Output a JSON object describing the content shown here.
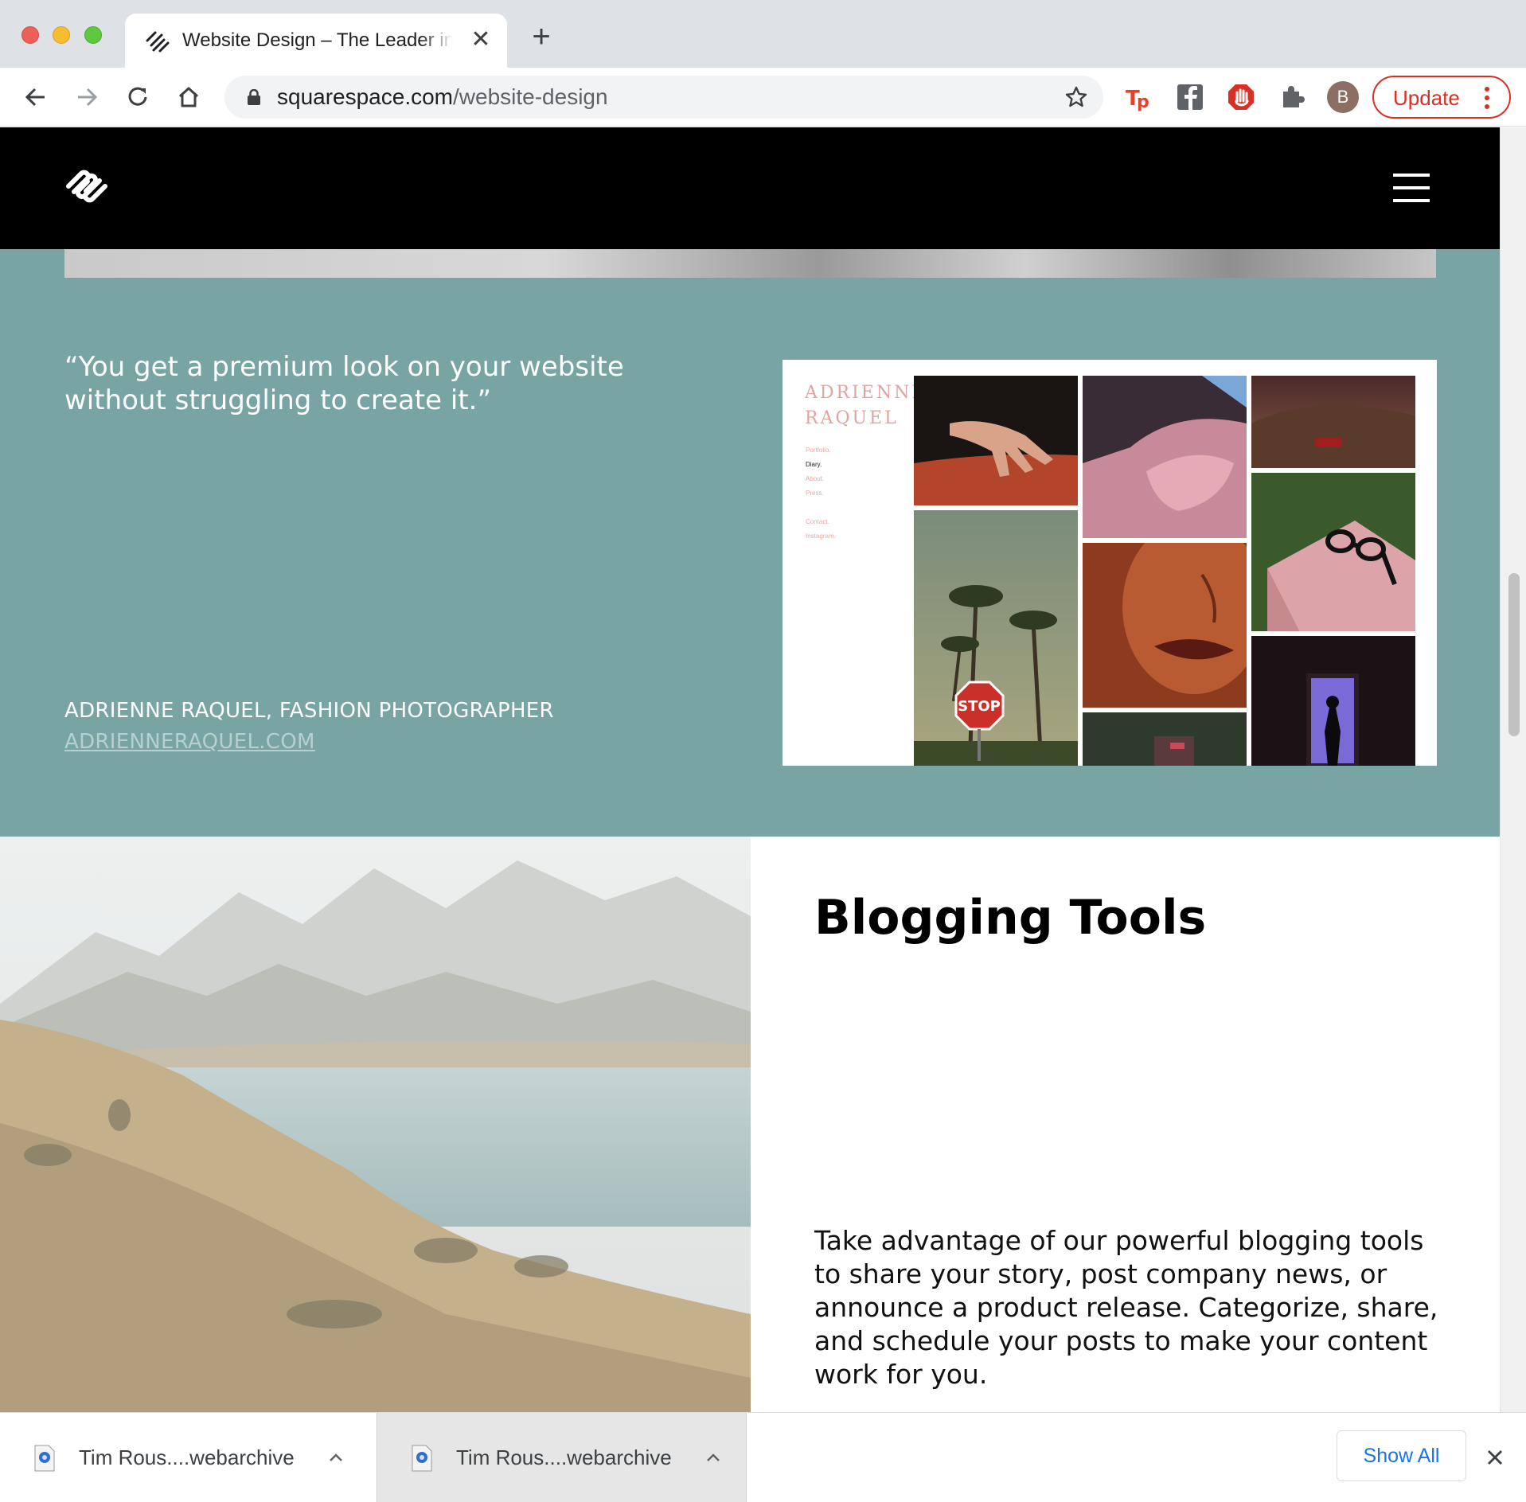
{
  "browser": {
    "tab_title": "Website Design – The Leader in Website Design",
    "new_tab_symbol": "+",
    "close_symbol": "✕",
    "url_host": "squarespace.com",
    "url_path": "/website-design",
    "profile_initial": "B",
    "update_label": "Update",
    "icons": [
      "back-icon",
      "forward-icon",
      "reload-icon",
      "home-icon",
      "lock-icon",
      "star-icon",
      "tp-extension-icon",
      "facebook-extension-icon",
      "adblock-extension-icon",
      "extensions-puzzle-icon",
      "more-vert-icon"
    ]
  },
  "page": {
    "testimonial": {
      "quote": "“You get a premium look on your website without struggling to create it.”",
      "author": "ADRIENNE RAQUEL, FASHION PHOTOGRAPHER",
      "link": "ADRIENNERAQUEL.COM"
    },
    "portfolio_preview": {
      "site_name": "ADRIENNE\nRAQUEL",
      "menu": [
        "Portfolio.",
        "Diary.",
        "About.",
        "Press.",
        "",
        "Contact.",
        "Instagram."
      ],
      "stop_sign_text": "STOP"
    },
    "blogging": {
      "title": "Blogging Tools",
      "description": "Take advantage of our powerful blogging tools to share your story, post company news, or announce a product release. Categorize, share, and schedule your posts to make your content work for you."
    }
  },
  "downloads": {
    "items": [
      {
        "name": "Tim Rous....webarchive"
      },
      {
        "name": "Tim Rous....webarchive"
      }
    ],
    "show_all_label": "Show All"
  },
  "colors": {
    "teal": "#78a4a3",
    "update_red": "#d93025",
    "link_blue": "#1a73e8"
  }
}
